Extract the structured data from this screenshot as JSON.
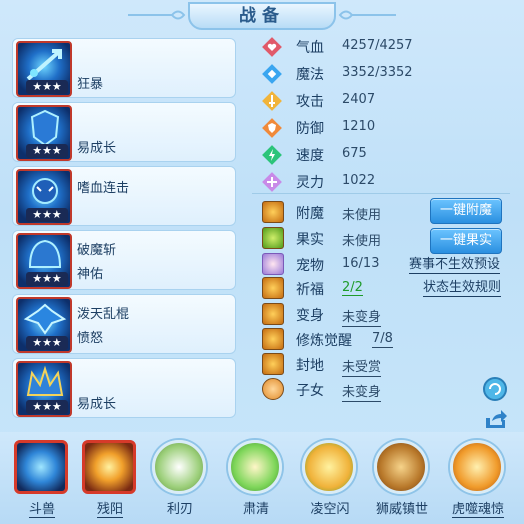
{
  "title": "战备",
  "skills": [
    {
      "name": "狂暴",
      "sub": "",
      "stars": "★★★"
    },
    {
      "name": "易成长",
      "sub": "",
      "stars": "★★★"
    },
    {
      "name": "嗜血连击",
      "sub": "",
      "stars": "★★★"
    },
    {
      "name": "破魔斩",
      "sub": "神佑",
      "stars": "★★★"
    },
    {
      "name": "泼天乱棍",
      "sub": "愤怒",
      "stars": "★★★"
    },
    {
      "name": "易成长",
      "sub": "",
      "stars": "★★★"
    }
  ],
  "stats": [
    {
      "label": "气血",
      "value": "4257/4257",
      "icon": "heart-icon",
      "color": "#e05a6a"
    },
    {
      "label": "魔法",
      "value": "3352/3352",
      "icon": "mana-icon",
      "color": "#3aa6f0"
    },
    {
      "label": "攻击",
      "value": "2407",
      "icon": "attack-icon",
      "color": "#f1b43a"
    },
    {
      "label": "防御",
      "value": "1210",
      "icon": "defense-icon",
      "color": "#f08a3a"
    },
    {
      "label": "速度",
      "value": "675",
      "icon": "speed-icon",
      "color": "#2bc47a"
    },
    {
      "label": "灵力",
      "value": "1022",
      "icon": "spirit-icon",
      "color": "#c88ae8"
    }
  ],
  "info": {
    "enchant": {
      "label": "附魔",
      "value": "未使用"
    },
    "fruit": {
      "label": "果实",
      "value": "未使用"
    },
    "pet": {
      "label": "宠物",
      "value": "16/13"
    },
    "blessing": {
      "label": "祈福",
      "value": "2/2"
    },
    "transform": {
      "label": "变身",
      "value": "未变身"
    },
    "awaken": {
      "label": "修炼觉醒",
      "value": "7/8"
    },
    "fief": {
      "label": "封地",
      "value": "未受赏"
    },
    "child": {
      "label": "子女",
      "value": "未变身"
    }
  },
  "buttons": {
    "enchant": "一键附魔",
    "fruit": "一键果实"
  },
  "links": {
    "event_preset": "赛事不生效预设",
    "status_rules": "状态生效规则"
  },
  "bottom": [
    {
      "label": "斗兽",
      "style": "square",
      "underline": true
    },
    {
      "label": "残阳",
      "style": "square2",
      "underline": true
    },
    {
      "label": "利刃",
      "style": "round",
      "underline": false,
      "color": "#9ccf7a"
    },
    {
      "label": "肃清",
      "style": "round",
      "underline": false,
      "color": "#7ed65a"
    },
    {
      "label": "凌空闪",
      "style": "round",
      "underline": false,
      "color": "#f0b23a"
    },
    {
      "label": "狮威镇世",
      "style": "round",
      "underline": false,
      "color": "#b8782a"
    },
    {
      "label": "虎噬魂惊",
      "style": "round",
      "underline": true,
      "color": "#f09a2a"
    }
  ]
}
